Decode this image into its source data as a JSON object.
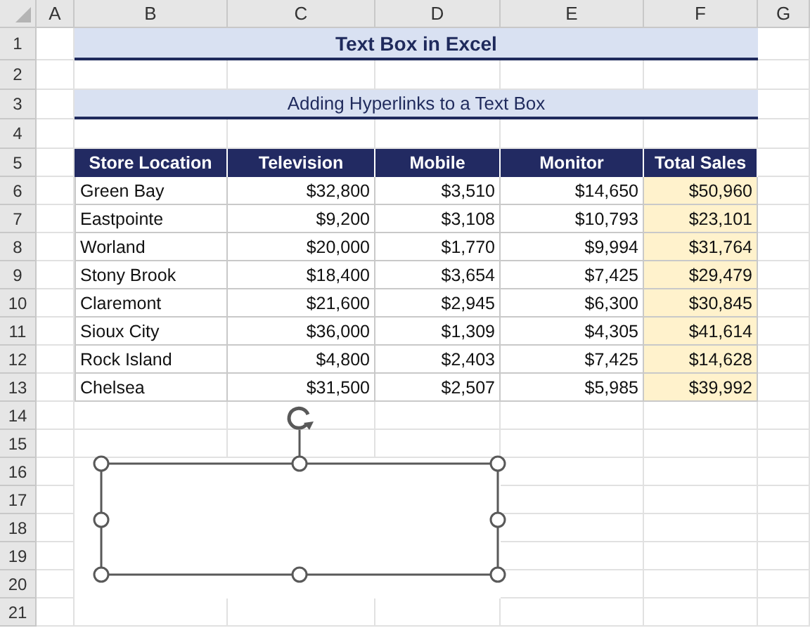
{
  "columns": [
    "A",
    "B",
    "C",
    "D",
    "E",
    "F",
    "G"
  ],
  "rows": [
    "1",
    "2",
    "3",
    "4",
    "5",
    "6",
    "7",
    "8",
    "9",
    "10",
    "11",
    "12",
    "13",
    "14",
    "15",
    "16",
    "17",
    "18",
    "19",
    "20",
    "21"
  ],
  "title": "Text Box in Excel",
  "subtitle": "Adding Hyperlinks to a Text Box",
  "table": {
    "columns": [
      "Store Location",
      "Television",
      "Mobile",
      "Monitor",
      "Total Sales"
    ],
    "rows": [
      [
        "Green Bay",
        "$32,800",
        "$3,510",
        "$14,650",
        "$50,960"
      ],
      [
        "Eastpointe",
        "$9,200",
        "$3,108",
        "$10,793",
        "$23,101"
      ],
      [
        "Worland",
        "$20,000",
        "$1,770",
        "$9,994",
        "$31,764"
      ],
      [
        "Stony Brook",
        "$18,400",
        "$3,654",
        "$7,425",
        "$29,479"
      ],
      [
        "Claremont",
        "$21,600",
        "$2,945",
        "$6,300",
        "$30,845"
      ],
      [
        "Sioux City",
        "$36,000",
        "$1,309",
        "$4,305",
        "$41,614"
      ],
      [
        "Rock Island",
        "$4,800",
        "$2,403",
        "$7,425",
        "$14,628"
      ],
      [
        "Chelsea",
        "$31,500",
        "$2,507",
        "$5,985",
        "$39,992"
      ]
    ]
  },
  "text_box": {
    "selected": true
  }
}
